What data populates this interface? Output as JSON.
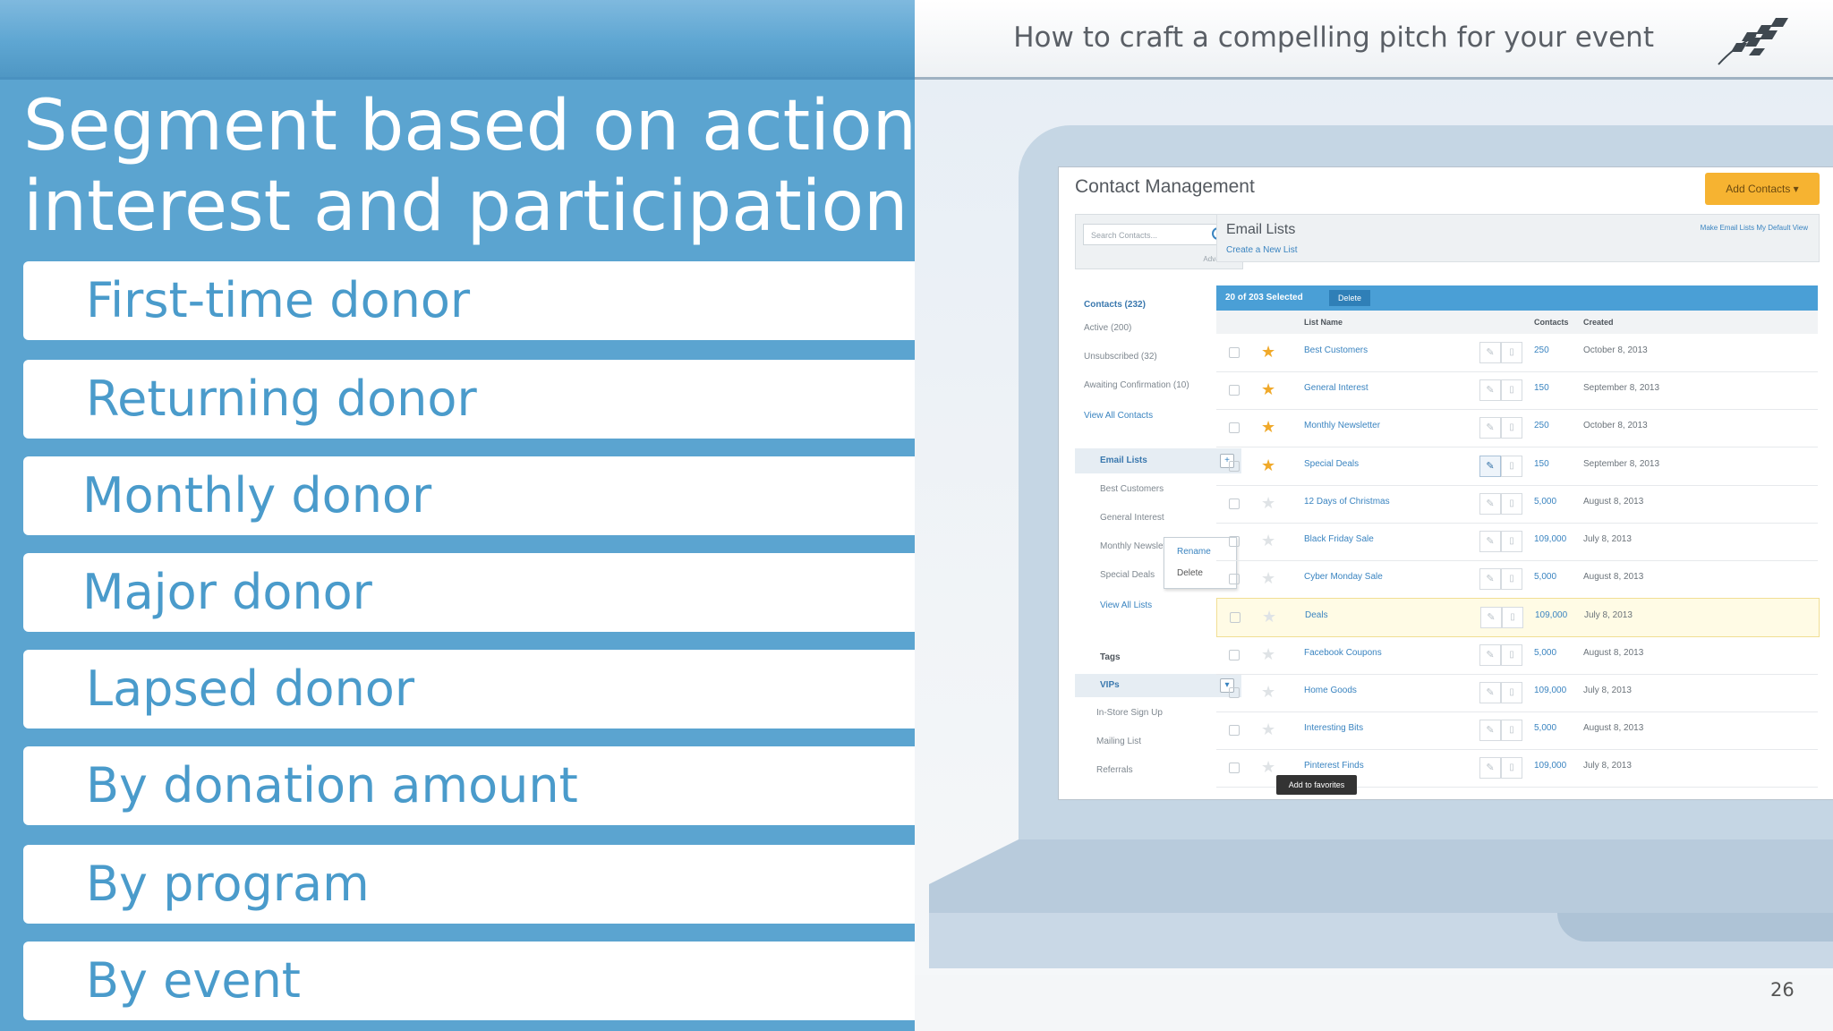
{
  "slide": {
    "title_line1": "Segment based on actions,",
    "title_line2": "interest and participation",
    "header_text": "How to craft a compelling pitch for your event",
    "page_number": "26",
    "segments": [
      "First-time donor",
      "Returning donor",
      "Monthly donor",
      "Major donor",
      "Lapsed donor",
      "By donation amount",
      "By program",
      "By event"
    ]
  },
  "colors": {
    "panel_blue": "#5ba4d0",
    "segment_text": "#4a9bcb",
    "accent_orange": "#f6b331"
  },
  "app": {
    "title": "Contact Management",
    "add_contacts": "Add Contacts ▾",
    "search_placeholder": "Search Contacts...",
    "advanced": "Advanced",
    "contacts_head": "Contacts (232)",
    "contacts_items": [
      "Active (200)",
      "Unsubscribed (32)",
      "Awaiting Confirmation (10)",
      "View All Contacts"
    ],
    "email_lists_head": "Email Lists",
    "email_list_items": [
      "Best Customers",
      "General Interest",
      "Monthly Newsletter",
      "Special Deals",
      "View All Lists"
    ],
    "context_menu": [
      "Rename",
      "Delete"
    ],
    "tags_head": "Tags",
    "vips": "VIPs",
    "tag_items": [
      "In-Store Sign Up",
      "Mailing List",
      "Referrals"
    ],
    "panel_title": "Email Lists",
    "create_list": "Create a New List",
    "make_default": "Make Email Lists My Default View",
    "selected_text": "20 of 203 Selected",
    "delete_label": "Delete",
    "col_list_name": "List Name",
    "col_contacts": "Contacts",
    "col_created": "Created",
    "tooltip": "Add to favorites",
    "rows": [
      {
        "name": "Best Customers",
        "contacts": "250",
        "created": "October 8, 2013",
        "star": true
      },
      {
        "name": "General Interest",
        "contacts": "150",
        "created": "September 8, 2013",
        "star": true
      },
      {
        "name": "Monthly Newsletter",
        "contacts": "250",
        "created": "October 8, 2013",
        "star": true
      },
      {
        "name": "Special Deals",
        "contacts": "150",
        "created": "September 8, 2013",
        "star": true
      },
      {
        "name": "12 Days of Christmas",
        "contacts": "5,000",
        "created": "August 8, 2013",
        "star": false
      },
      {
        "name": "Black Friday Sale",
        "contacts": "109,000",
        "created": "July 8, 2013",
        "star": false
      },
      {
        "name": "Cyber Monday Sale",
        "contacts": "5,000",
        "created": "August 8, 2013",
        "star": false
      },
      {
        "name": "Deals",
        "contacts": "109,000",
        "created": "July 8, 2013",
        "star": false
      },
      {
        "name": "Facebook Coupons",
        "contacts": "5,000",
        "created": "August 8, 2013",
        "star": false
      },
      {
        "name": "Home Goods",
        "contacts": "109,000",
        "created": "July 8, 2013",
        "star": false
      },
      {
        "name": "Interesting Bits",
        "contacts": "5,000",
        "created": "August 8, 2013",
        "star": false
      },
      {
        "name": "Pinterest Finds",
        "contacts": "109,000",
        "created": "July 8, 2013",
        "star": false
      }
    ]
  }
}
